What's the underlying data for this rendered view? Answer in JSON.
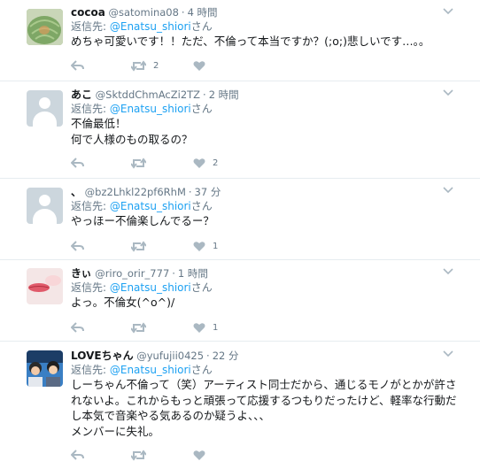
{
  "tweets": [
    {
      "name": "cocoa",
      "handle": "@satomina08",
      "time": "4 時間",
      "reply_prefix": "返信先: ",
      "reply_to": "@Enatsu_shiori",
      "reply_suffix": "さん",
      "text": [
        "めちゃ可愛いです！！ただ、不倫って本当ですか？(;o;)悲しいです…。。"
      ],
      "retweets": "2",
      "likes": "",
      "avatar": "melon-photo"
    },
    {
      "name": "あこ",
      "handle": "@SktddChmAcZi2TZ",
      "time": "2 時間",
      "reply_prefix": "返信先: ",
      "reply_to": "@Enatsu_shiori",
      "reply_suffix": "さん",
      "text": [
        "不倫最低！",
        "何で人様のもの取るの？"
      ],
      "retweets": "",
      "likes": "2",
      "avatar": "default-egg"
    },
    {
      "name": "、",
      "handle": "@bz2Lhkl22pf6RhM",
      "time": "37 分",
      "reply_prefix": "返信先: ",
      "reply_to": "@Enatsu_shiori",
      "reply_suffix": "さん",
      "text": [
        "やっほー不倫楽しんでるー？"
      ],
      "retweets": "",
      "likes": "1",
      "avatar": "default-egg"
    },
    {
      "name": "きぃ",
      "handle": "@riro_orir_777",
      "time": "1 時間",
      "reply_prefix": "返信先: ",
      "reply_to": "@Enatsu_shiori",
      "reply_suffix": "さん",
      "text": [
        "よっ。不倫女(^o^)/"
      ],
      "retweets": "",
      "likes": "1",
      "avatar": "lips-photo"
    },
    {
      "name": "LOVEちゃん",
      "handle": "@yufujii0425",
      "time": "22 分",
      "reply_prefix": "返信先: ",
      "reply_to": "@Enatsu_shiori",
      "reply_suffix": "さん",
      "text": [
        "しーちゃん不倫って（笑）アーティスト同士だから、通じるモノがとかが許さ",
        "れないよ。これからもっと頑張って応援するつもりだったけど、軽率な行動だ",
        "し本気で音楽やる気あるのか疑うよ、、、",
        "メンバーに失礼。"
      ],
      "retweets": "",
      "likes": "",
      "avatar": "group-photo"
    }
  ],
  "colors": {
    "link": "#1da1f2",
    "muted": "#657786",
    "icon": "#aab8c2",
    "divider": "#e6ecf0"
  }
}
